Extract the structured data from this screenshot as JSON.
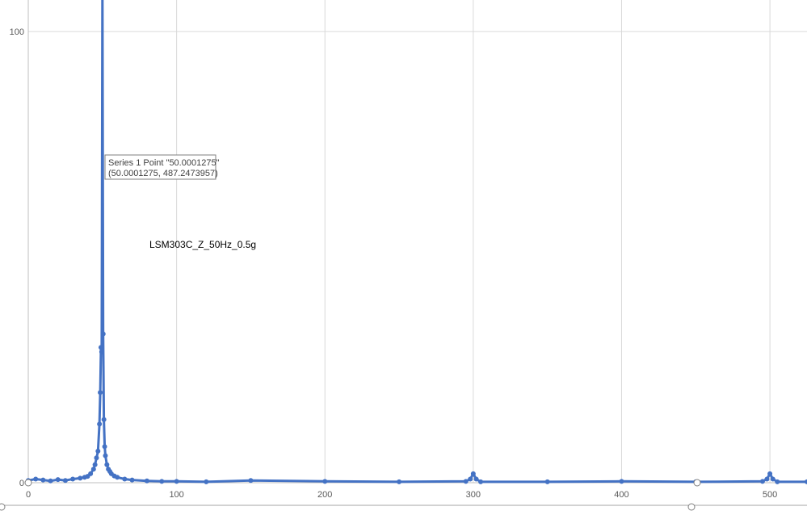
{
  "chart_data": {
    "type": "scatter",
    "title": "",
    "xlabel": "",
    "ylabel": "",
    "xlim": [
      0,
      525
    ],
    "ylim": [
      0,
      107
    ],
    "x_ticks": [
      0,
      100,
      200,
      300,
      400,
      500
    ],
    "y_ticks": [
      0,
      100
    ],
    "grid": true,
    "series_color": "#4472C4",
    "annotation": "LSM303C_Z_50Hz_0.5g",
    "tooltip": {
      "line1": "Series 1 Point \"50.0001275\"",
      "line2": "(50.0001275, 487.2473957)"
    },
    "series": [
      {
        "peak": {
          "x": 50.0001275,
          "y": 487.2473957
        },
        "x": [
          0,
          5,
          10,
          15,
          20,
          25,
          30,
          35,
          38,
          40,
          42,
          44,
          45,
          46,
          47,
          48,
          48.5,
          49,
          49.5,
          50.0001275,
          50.5,
          51,
          51.5,
          52,
          53,
          54,
          55,
          56,
          58,
          60,
          65,
          70,
          80,
          90,
          100,
          120,
          150,
          200,
          250,
          295,
          298,
          300,
          302,
          305,
          350,
          400,
          450,
          495,
          498,
          500,
          502,
          505,
          525
        ],
        "y": [
          0.5,
          0.8,
          0.6,
          0.4,
          0.7,
          0.5,
          0.8,
          1.0,
          1.2,
          1.4,
          2.0,
          3.0,
          4.0,
          5.5,
          7.0,
          13.0,
          20.0,
          30.0,
          29.0,
          487.2473957,
          33.0,
          14.0,
          8.0,
          6.0,
          4.0,
          3.0,
          2.5,
          2.0,
          1.5,
          1.2,
          0.8,
          0.6,
          0.4,
          0.3,
          0.3,
          0.2,
          0.5,
          0.3,
          0.2,
          0.3,
          0.8,
          2.0,
          0.8,
          0.2,
          0.2,
          0.3,
          0.2,
          0.3,
          0.8,
          2.0,
          0.8,
          0.2,
          0.2
        ]
      }
    ]
  }
}
